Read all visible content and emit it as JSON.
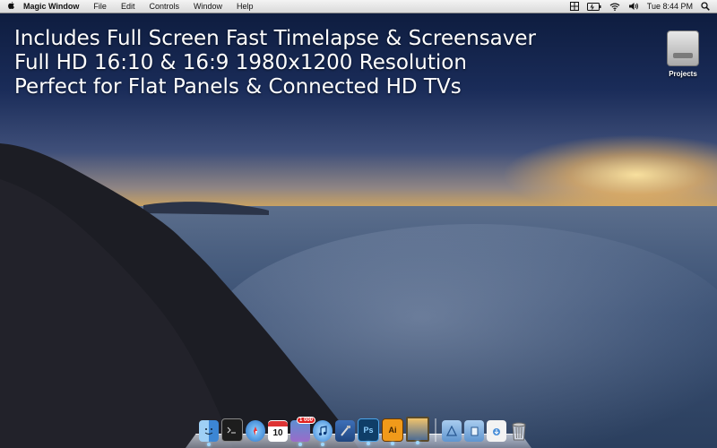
{
  "menubar": {
    "apple_icon": "apple-icon",
    "app_name": "Magic Window",
    "menus": [
      "File",
      "Edit",
      "Controls",
      "Window",
      "Help"
    ],
    "status_icons": [
      "grid-icon",
      "battery-icon",
      "wifi-icon",
      "volume-icon"
    ],
    "clock": "Tue 8:44 PM",
    "spotlight_icon": "search-icon"
  },
  "headline": {
    "line1": "Includes Full Screen Fast Timelapse & Screensaver",
    "line2": "Full HD 16:10 & 16:9 1980x1200 Resolution",
    "line3": "Perfect for Flat Panels & Connected HD TVs"
  },
  "desktop": {
    "drive_label": "Projects"
  },
  "dock": {
    "calendar_day": "10",
    "notification_badge": "1 000",
    "apps": [
      {
        "name": "finder-icon",
        "running": true
      },
      {
        "name": "terminal-icon",
        "running": false
      },
      {
        "name": "safari-icon",
        "running": false
      },
      {
        "name": "calendar-icon",
        "running": false
      },
      {
        "name": "preview-icon",
        "running": true
      },
      {
        "name": "itunes-icon",
        "running": true
      },
      {
        "name": "xcode-icon",
        "running": false
      },
      {
        "name": "photoshop-icon",
        "label": "Ps",
        "running": true
      },
      {
        "name": "illustrator-icon",
        "label": "Ai",
        "running": true
      },
      {
        "name": "magic-window-icon",
        "running": true
      }
    ],
    "stacks": [
      "applications-folder-icon",
      "documents-folder-icon",
      "downloads-stack-icon",
      "trash-icon"
    ]
  }
}
